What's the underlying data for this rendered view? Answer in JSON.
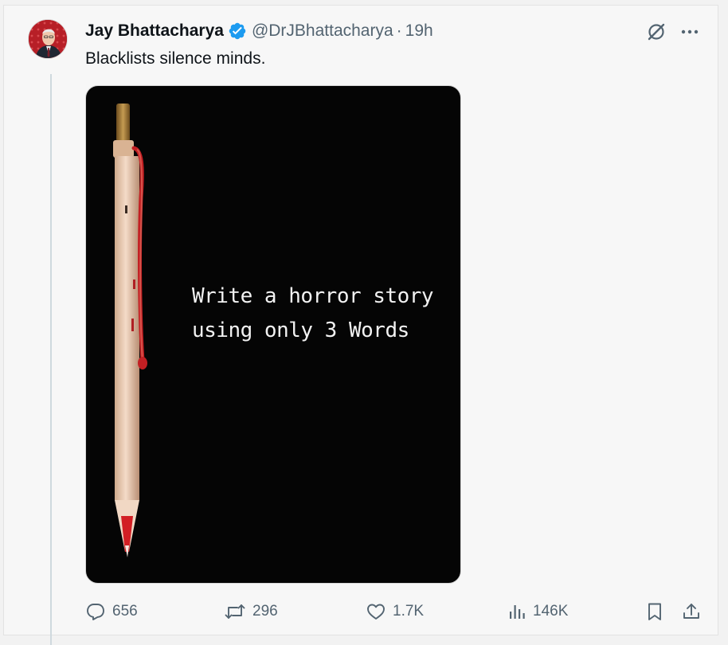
{
  "tweet": {
    "author_name": "Jay Bhattacharya",
    "handle": "@DrJBhattacharya",
    "separator": "·",
    "time": "19h",
    "text": "Blacklists silence minds.",
    "verified_badge_color": "#1d9bf0"
  },
  "media": {
    "line1": "Write a horror story",
    "line2": "using only 3 Words",
    "background": "#050505"
  },
  "actions": {
    "replies": "656",
    "reposts": "296",
    "likes": "1.7K",
    "views": "146K"
  },
  "icons": {
    "top": [
      "grok-icon",
      "more-icon"
    ],
    "bottom": [
      "reply-icon",
      "repost-icon",
      "like-icon",
      "views-icon",
      "bookmark-icon",
      "share-icon"
    ]
  }
}
